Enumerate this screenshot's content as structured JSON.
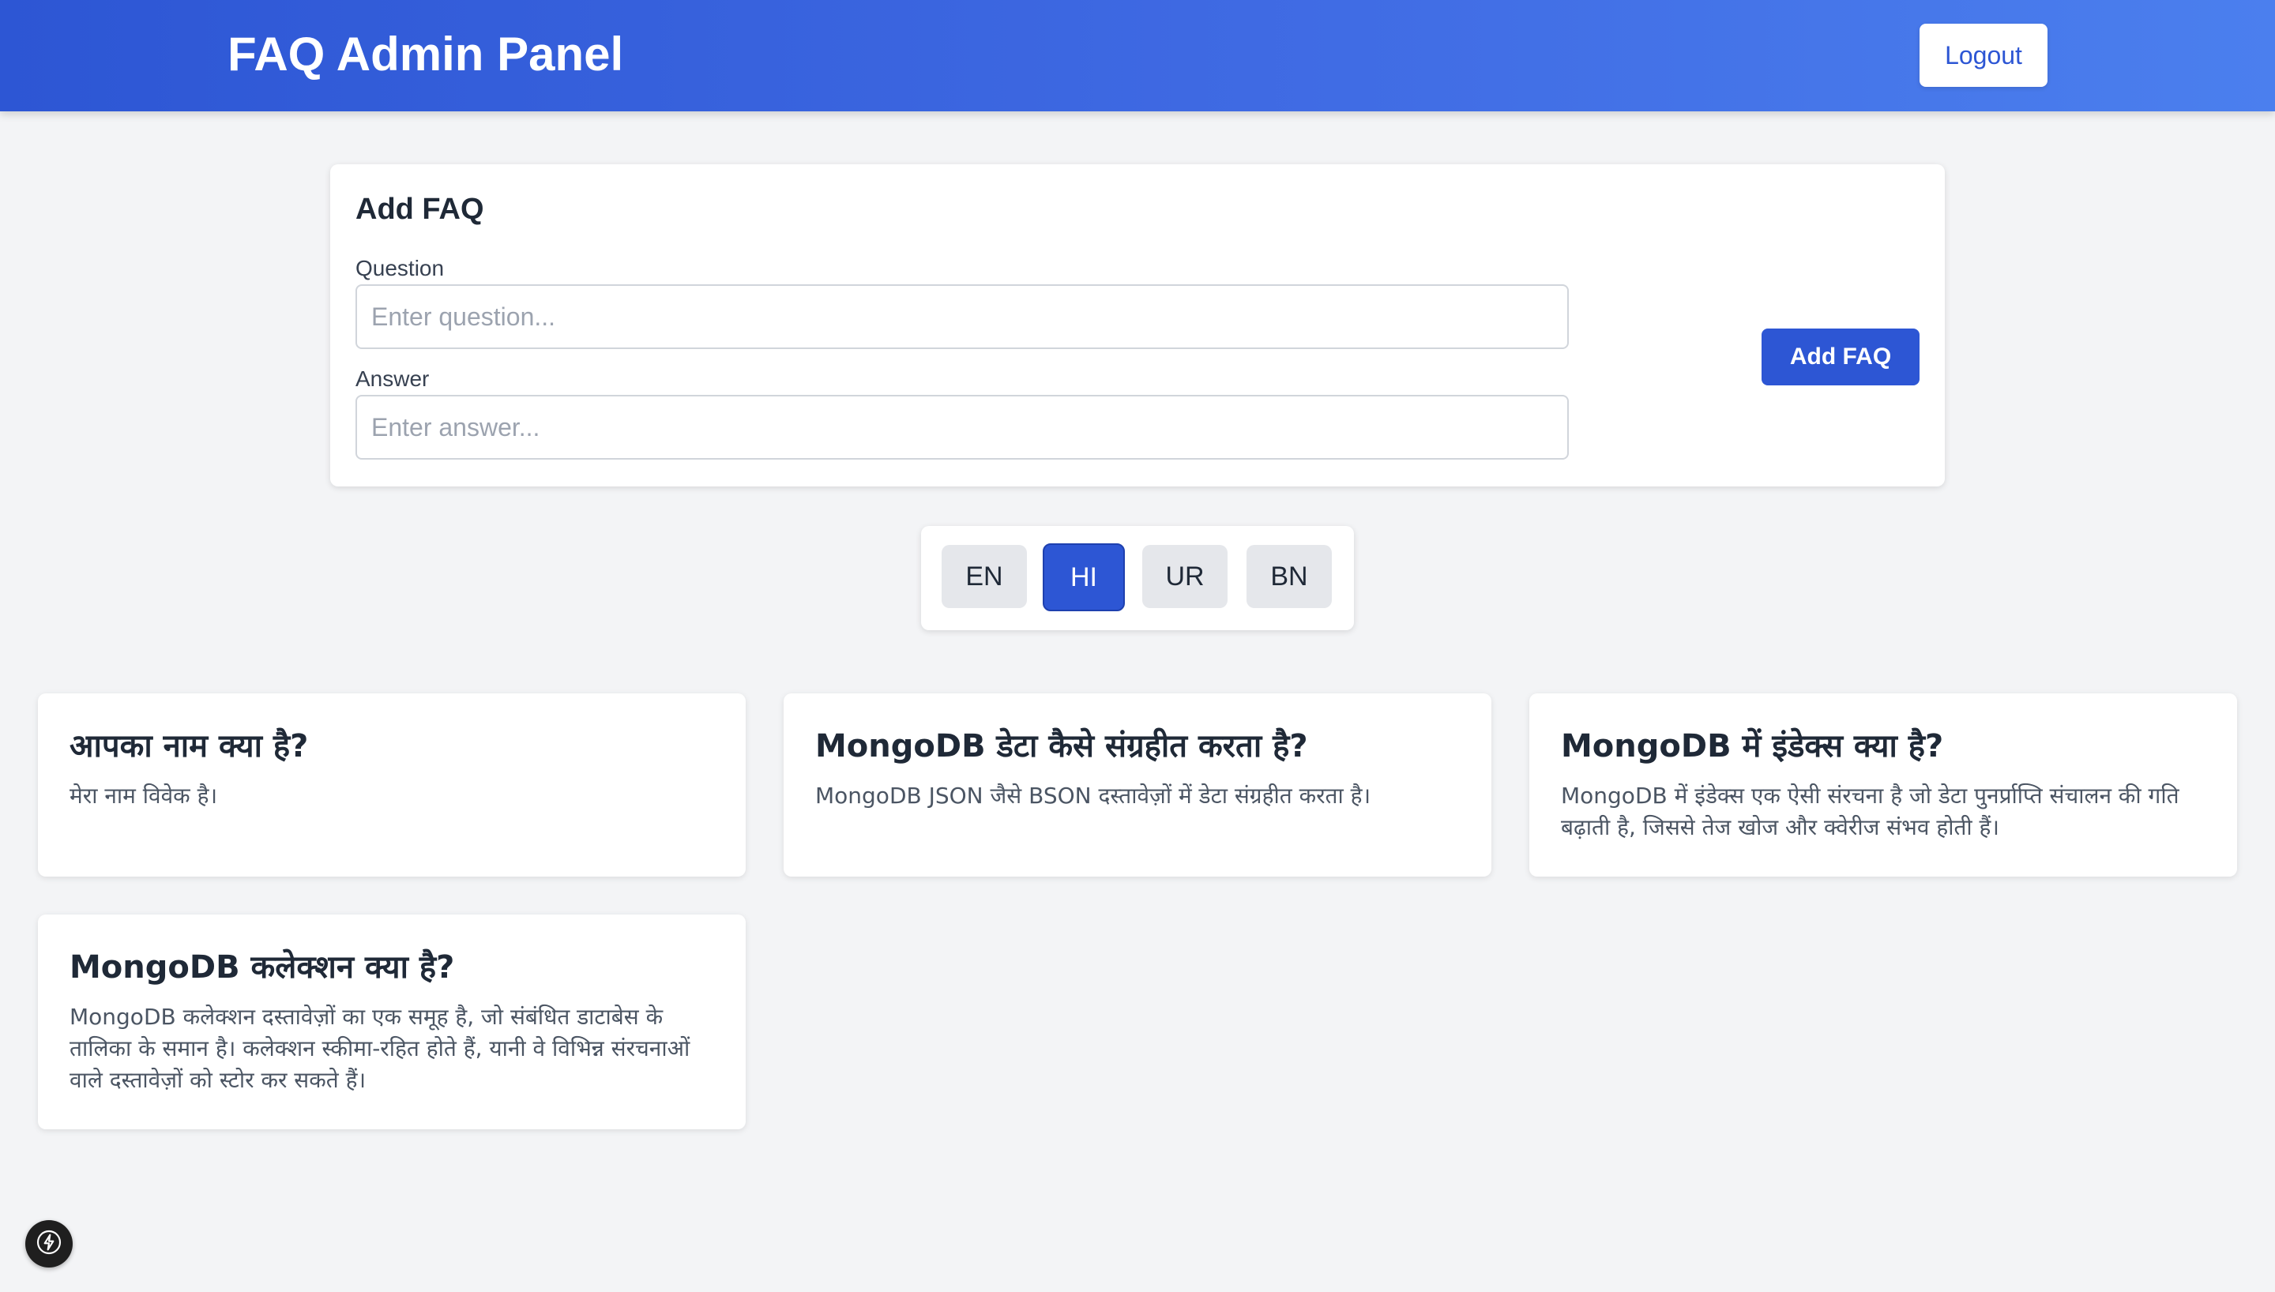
{
  "header": {
    "title": "FAQ Admin Panel",
    "logout_label": "Logout"
  },
  "form": {
    "title": "Add FAQ",
    "question_label": "Question",
    "question_placeholder": "Enter question...",
    "answer_label": "Answer",
    "answer_placeholder": "Enter answer...",
    "submit_label": "Add FAQ"
  },
  "languages": {
    "selected": "HI",
    "items": [
      {
        "label": "EN"
      },
      {
        "label": "HI"
      },
      {
        "label": "UR"
      },
      {
        "label": "BN"
      }
    ]
  },
  "faqs": [
    {
      "question": "आपका नाम क्या है?",
      "answer": "मेरा नाम विवेक है।"
    },
    {
      "question": "MongoDB डेटा कैसे संग्रहीत करता है?",
      "answer": "MongoDB JSON जैसे BSON दस्तावेज़ों में डेटा संग्रहीत करता है।"
    },
    {
      "question": "MongoDB में इंडेक्स क्या है?",
      "answer": "MongoDB में इंडेक्स एक ऐसी संरचना है जो डेटा पुनर्प्राप्ति संचालन की गति बढ़ाती है, जिससे तेज खोज और क्वेरीज संभव होती हैं।"
    },
    {
      "question": "MongoDB कलेक्शन क्या है?",
      "answer": "MongoDB कलेक्शन दस्तावेज़ों का एक समूह है, जो संबंधित डाटाबेस के तालिका के समान है। कलेक्शन स्कीमा-रहित होते हैं, यानी वे विभिन्न संरचनाओं वाले दस्तावेज़ों को स्टोर कर सकते हैं।"
    }
  ],
  "colors": {
    "primary": "#2d56d4",
    "background": "#f3f4f6"
  },
  "floating_button": {
    "icon": "lightning-bolt-icon"
  }
}
